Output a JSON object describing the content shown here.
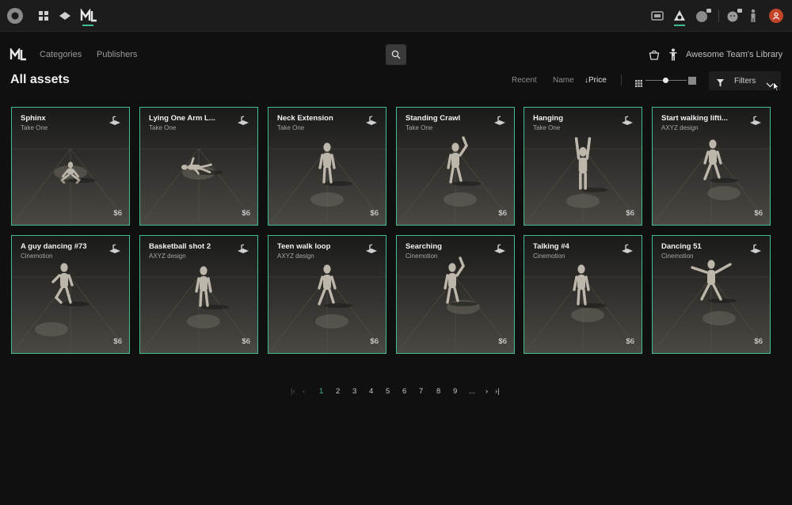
{
  "topbar": {
    "icons": [
      "app-logo-icon",
      "grid-icon",
      "diamond-icon",
      "motion-library-icon",
      "film-icon",
      "scene-icon",
      "sphere-icon",
      "face-icon",
      "figure-icon",
      "avatar-icon"
    ],
    "accent": "#3fbf8f",
    "avatar_color": "#c2452a"
  },
  "nav": {
    "categories": "Categories",
    "publishers": "Publishers",
    "library": "Awesome Team's Library"
  },
  "page": {
    "title": "All assets"
  },
  "sort": {
    "recent": "Recent",
    "name": "Name",
    "price": "↓Price"
  },
  "filters": {
    "label": "Filters"
  },
  "cards": [
    {
      "title": "Sphinx",
      "publisher": "Take One",
      "price": "$6"
    },
    {
      "title": "Lying One Arm L...",
      "publisher": "Take One",
      "price": "$6"
    },
    {
      "title": "Neck Extension",
      "publisher": "Take One",
      "price": "$6"
    },
    {
      "title": "Standing Crawl",
      "publisher": "Take One",
      "price": "$6"
    },
    {
      "title": "Hanging",
      "publisher": "Take One",
      "price": "$6"
    },
    {
      "title": "Start walking lifti...",
      "publisher": "AXYZ design",
      "price": "$6"
    },
    {
      "title": "A guy dancing #73",
      "publisher": "Cinemotion",
      "price": "$6"
    },
    {
      "title": "Basketball shot 2",
      "publisher": "AXYZ design",
      "price": "$6"
    },
    {
      "title": "Teen walk loop",
      "publisher": "AXYZ design",
      "price": "$6"
    },
    {
      "title": "Searching",
      "publisher": "Cinemotion",
      "price": "$6"
    },
    {
      "title": "Talking #4",
      "publisher": "Cinemotion",
      "price": "$6"
    },
    {
      "title": "Dancing 51",
      "publisher": "Cinemotion",
      "price": "$6"
    }
  ],
  "pagination": {
    "first": "|‹",
    "prev": "‹",
    "pages": [
      "1",
      "2",
      "3",
      "4",
      "5",
      "6",
      "7",
      "8",
      "9",
      "..."
    ],
    "current": "1",
    "next": "›",
    "last": "›|"
  }
}
